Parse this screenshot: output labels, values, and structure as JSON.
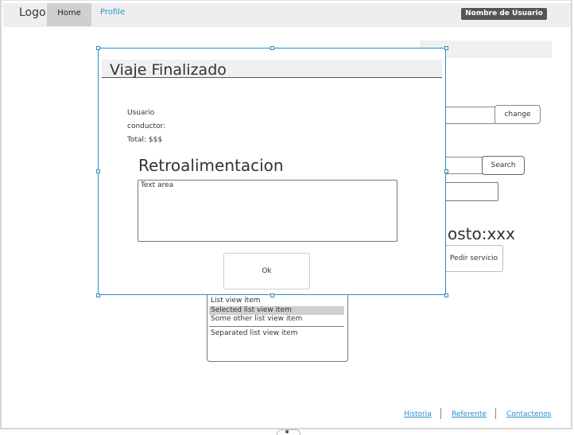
{
  "header": {
    "logo": "Logo",
    "tabs": [
      {
        "label": "Home",
        "active": true
      },
      {
        "label": "Profile",
        "active": false
      }
    ],
    "user_badge": "Nombre de Usuario"
  },
  "background": {
    "change_button": "change",
    "search_button": "Search",
    "costo_text": "osto:xxx",
    "pedir_button": "Pedir servicio",
    "list_view": {
      "items": [
        "List view item",
        "Selected list view item",
        "Some other list view item"
      ],
      "separated_item": "Separated list view item",
      "selected_index": 1
    }
  },
  "dialog": {
    "title": "Viaje Finalizado",
    "fields": {
      "usuario_label": "Usuario",
      "conductor_label": "conductor:",
      "total_label": "Total: $$$"
    },
    "feedback_heading": "Retroalimentacion",
    "textarea_placeholder": "Text area",
    "ok_button": "Ok"
  },
  "footer": {
    "links": [
      "Historia",
      "Referente",
      "Contactenos"
    ]
  },
  "colors": {
    "accent": "#2b8fd1",
    "selection_border": "#2a8fbf",
    "badge_bg": "#555555",
    "topbar_bg": "#eeeeee",
    "active_tab_bg": "#cfcfcf"
  }
}
